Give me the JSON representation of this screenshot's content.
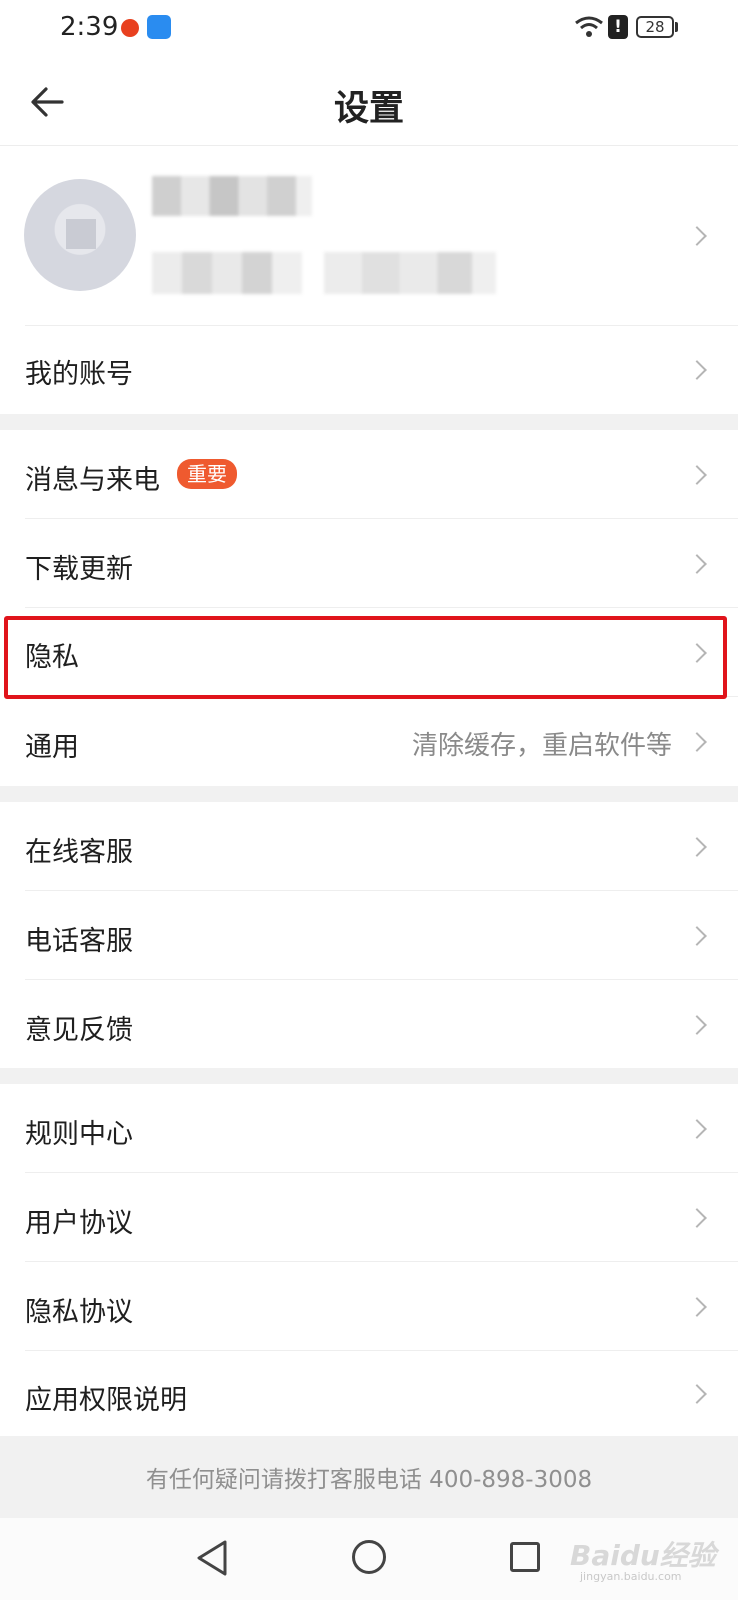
{
  "status_bar": {
    "time": "2:39",
    "battery": "28",
    "alert": "!"
  },
  "header": {
    "title": "设置",
    "back_icon": "arrow-left-icon"
  },
  "profile": {
    "avatar": "blurred-avatar"
  },
  "sections": [
    {
      "items": [
        {
          "label": "我的账号"
        }
      ]
    },
    {
      "items": [
        {
          "label": "消息与来电",
          "badge": "重要"
        },
        {
          "label": "下载更新"
        },
        {
          "label": "隐私"
        },
        {
          "label": "通用",
          "hint": "清除缓存，重启软件等"
        }
      ]
    },
    {
      "items": [
        {
          "label": "在线客服"
        },
        {
          "label": "电话客服"
        },
        {
          "label": "意见反馈"
        }
      ]
    },
    {
      "items": [
        {
          "label": "规则中心"
        },
        {
          "label": "用户协议"
        },
        {
          "label": "隐私协议"
        },
        {
          "label": "应用权限说明"
        }
      ]
    }
  ],
  "footer": {
    "text": "有任何疑问请拨打客服电话 400-898-3008"
  },
  "highlight_color": "#e0141b",
  "badge_color": "#ef5a2f",
  "watermark": {
    "text": "Baidu经验",
    "sub": "jingyan.baidu.com"
  }
}
